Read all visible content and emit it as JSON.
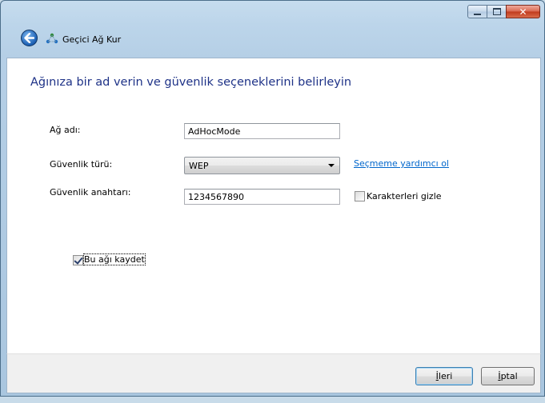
{
  "window": {
    "title": "Geçici Ağ Kur"
  },
  "content": {
    "heading": "Ağınıza bir ad verin ve güvenlik seçeneklerini belirleyin",
    "network_name": {
      "label": "Ağ adı:",
      "value": "AdHocMode"
    },
    "security_type": {
      "label": "Güvenlik türü:",
      "selected": "WEP",
      "help_link": "Seçmeme yardımcı ol"
    },
    "security_key": {
      "label": "Güvenlik anahtarı:",
      "value": "1234567890",
      "hide_chars_label": "Karakterleri gizle",
      "hide_chars_checked": false
    },
    "save_network": {
      "label": "Bu ağı kaydet",
      "checked": true
    }
  },
  "footer": {
    "next_first_letter": "İ",
    "next_rest": "leri",
    "cancel_first_letter": "İ",
    "cancel_rest": "ptal"
  },
  "icons": {
    "back": "back-arrow-icon",
    "app": "adhoc-network-icon",
    "minimize": "minimize-icon",
    "maximize": "maximize-icon",
    "close": "close-icon"
  }
}
